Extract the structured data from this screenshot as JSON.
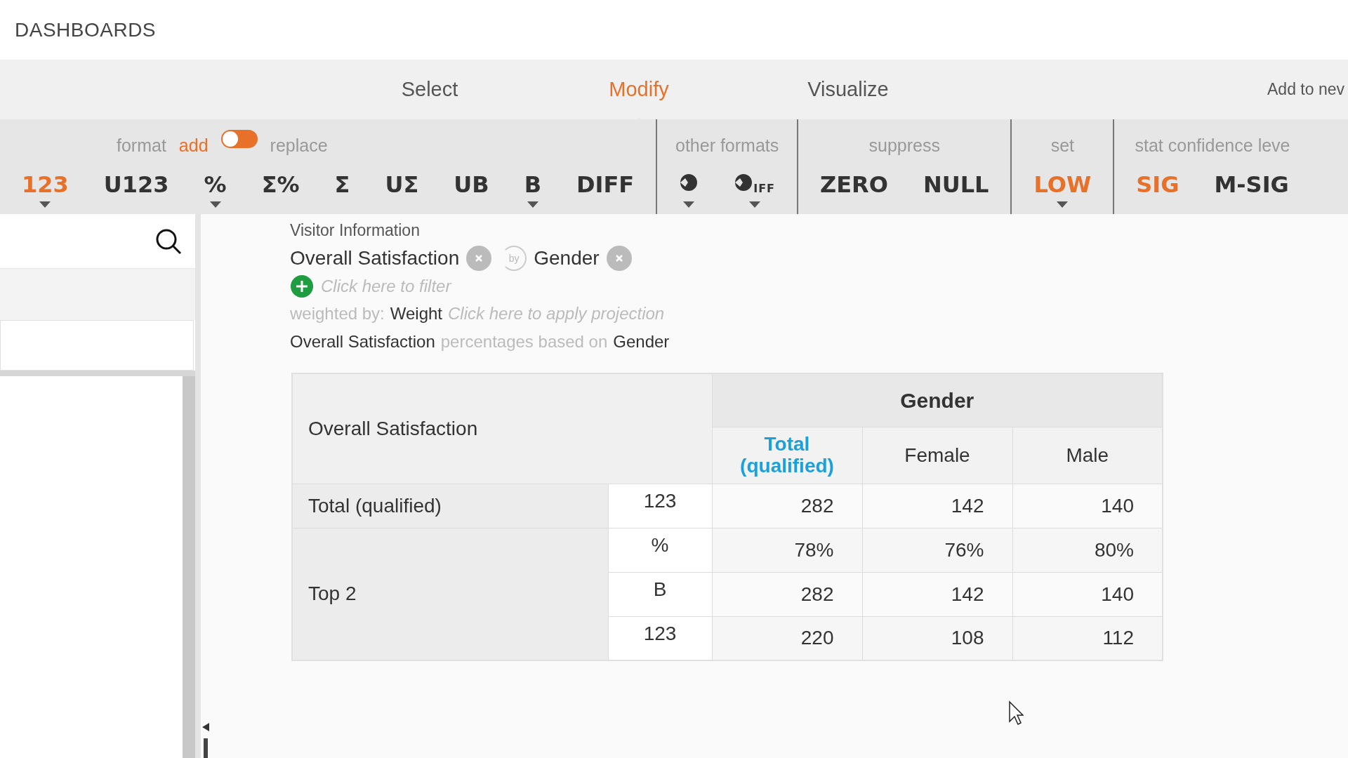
{
  "header": {
    "title": "DASHBOARDS"
  },
  "tabs": [
    {
      "label": "Select",
      "selected": false
    },
    {
      "label": "Modify",
      "selected": true
    },
    {
      "label": "Visualize",
      "selected": false
    }
  ],
  "add_to_new": "Add to nev",
  "toolbar": {
    "groups": [
      {
        "label": "format",
        "toggle": {
          "left": "add",
          "right": "replace",
          "on": false
        },
        "items": [
          {
            "kind": "text",
            "label": "123",
            "selected": true,
            "menu": true
          },
          {
            "kind": "text",
            "label": "U123",
            "selected": false,
            "menu": false
          },
          {
            "kind": "text",
            "label": "%",
            "selected": false,
            "menu": true
          },
          {
            "kind": "text",
            "label": "Σ%",
            "selected": false,
            "menu": false
          },
          {
            "kind": "text",
            "label": "Σ",
            "selected": false,
            "menu": false
          },
          {
            "kind": "text",
            "label": "UΣ",
            "selected": false,
            "menu": false
          },
          {
            "kind": "text",
            "label": "UB",
            "selected": false,
            "menu": false
          },
          {
            "kind": "text",
            "label": "B",
            "selected": false,
            "menu": true
          },
          {
            "kind": "text",
            "label": "DIFF",
            "selected": false,
            "menu": false
          }
        ]
      },
      {
        "label": "other formats",
        "items": [
          {
            "kind": "pie",
            "selected": false,
            "menu": true
          },
          {
            "kind": "pie-text",
            "label": "IFF",
            "selected": false,
            "menu": true
          }
        ]
      },
      {
        "label": "suppress",
        "items": [
          {
            "kind": "text",
            "label": "ZERO",
            "selected": false,
            "menu": false
          },
          {
            "kind": "text",
            "label": "NULL",
            "selected": false,
            "menu": false
          }
        ]
      },
      {
        "label": "set",
        "items": [
          {
            "kind": "text",
            "label": "LOW",
            "selected": true,
            "menu": true
          }
        ]
      },
      {
        "label": "stat confidence leve",
        "items": [
          {
            "kind": "text",
            "label": "SIG",
            "selected": true,
            "menu": false
          },
          {
            "kind": "text",
            "label": "M-SIG",
            "selected": false,
            "menu": false
          }
        ]
      }
    ]
  },
  "query": {
    "source": "Visitor Information",
    "variables": [
      {
        "label": "Overall Satisfaction"
      },
      {
        "label": "Gender"
      }
    ],
    "connector": "by",
    "filter_placeholder": "Click here to filter",
    "weight": {
      "prefix": "weighted by:",
      "value": "Weight",
      "projection_placeholder": "Click here to apply projection"
    },
    "basis": {
      "row_var": "Overall Satisfaction",
      "text": "percentages based on",
      "col_var": "Gender"
    }
  },
  "table": {
    "row_header": "Overall Satisfaction",
    "column_group": "Gender",
    "columns": [
      {
        "label": "Total (qualified)",
        "highlight": true
      },
      {
        "label": "Female",
        "highlight": false
      },
      {
        "label": "Male",
        "highlight": false
      }
    ],
    "groups": [
      {
        "label": "Total (qualified)",
        "rows": [
          {
            "format": "123",
            "values": [
              "282",
              "142",
              "140"
            ]
          }
        ]
      },
      {
        "label": "Top 2",
        "rows": [
          {
            "format": "%",
            "values": [
              "78%",
              "76%",
              "80%"
            ]
          },
          {
            "format": "B",
            "values": [
              "282",
              "142",
              "140"
            ]
          },
          {
            "format": "123",
            "values": [
              "220",
              "108",
              "112"
            ]
          }
        ]
      }
    ]
  }
}
